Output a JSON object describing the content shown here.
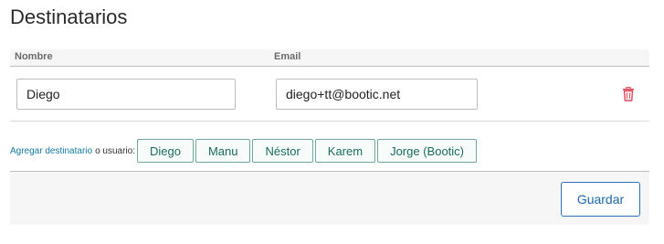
{
  "page": {
    "title": "Destinatarios"
  },
  "table": {
    "columns": {
      "nombre": "Nombre",
      "email": "Email"
    },
    "rows": [
      {
        "name": "Diego",
        "email": "diego+tt@bootic.net",
        "delete_icon": "trash-icon"
      }
    ]
  },
  "recipients": {
    "add_link": "Agregar destinatario",
    "or_text": "o usuario:",
    "users": [
      "Diego",
      "Manu",
      "Néstor",
      "Karem",
      "Jorge (Bootic)"
    ]
  },
  "footer": {
    "save_label": "Guardar"
  },
  "colors": {
    "accent_blue": "#2a74b7",
    "user_button_green": "#1b6b5e",
    "delete_red": "#e04a5a",
    "link_teal": "#137a9e"
  }
}
